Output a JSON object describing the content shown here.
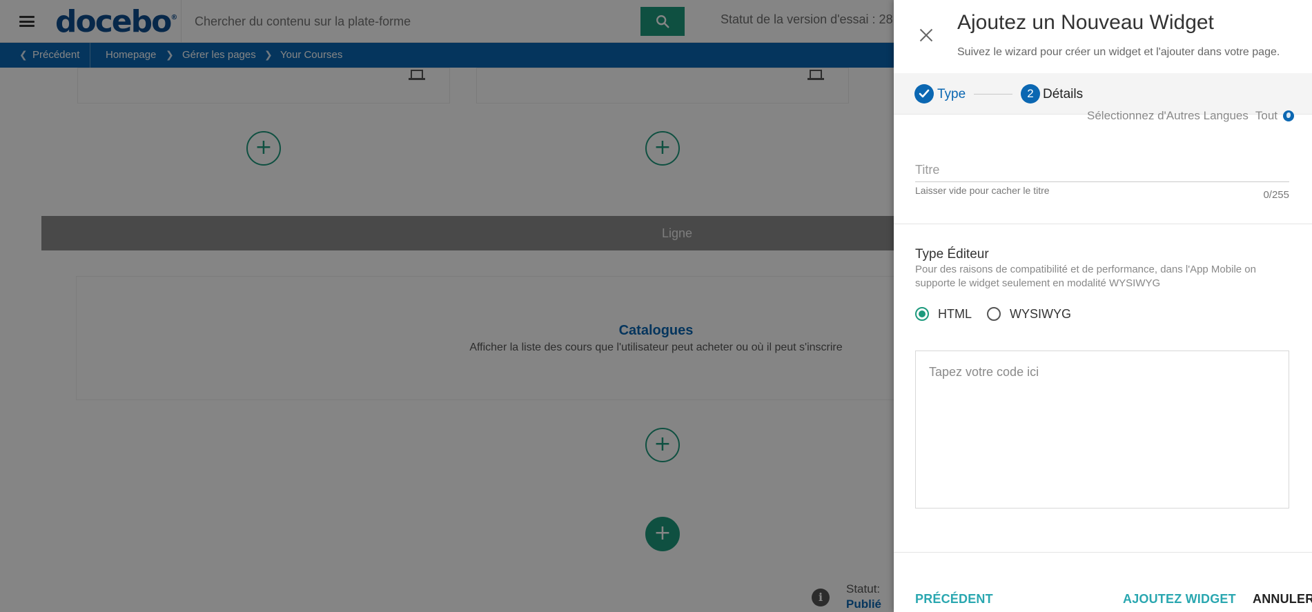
{
  "header": {
    "logo": "docebo",
    "logo_mark": "®",
    "search_placeholder": "Chercher du contenu sur la plate-forme",
    "trial_status": "Statut de la version d'essai : 28"
  },
  "breadcrumb": {
    "back": "Précédent",
    "items": [
      "Homepage",
      "Gérer les pages",
      "Your Courses"
    ]
  },
  "page": {
    "row_label": "Ligne",
    "catalog_title": "Catalogues",
    "catalog_desc": "Afficher la liste des cours que l'utilisateur peut acheter ou où il peut s'inscrire",
    "add_symbol": "+",
    "status_label": "Statut:",
    "status_value": "Publié",
    "info_symbol": "i"
  },
  "panel": {
    "title": "Ajoutez un Nouveau Widget",
    "subtitle": "Suivez le wizard pour créer un widget et l'ajouter dans votre page.",
    "steps": [
      {
        "number": "1",
        "label": "Type",
        "done": true
      },
      {
        "number": "2",
        "label": "Détails",
        "done": false
      }
    ],
    "languages_label": "Sélectionnez d'Autres Langues",
    "languages_value": "Tout",
    "title_field": {
      "placeholder": "Titre",
      "value": "",
      "help": "Laisser vide pour cacher le titre",
      "counter": "0/255"
    },
    "editor": {
      "label": "Type Éditeur",
      "help": "Pour des raisons de compatibilité et de performance, dans l'App Mobile on supporte le widget seulement en modalité WYSIWYG",
      "options": [
        "HTML",
        "WYSIWYG"
      ],
      "selected": "HTML"
    },
    "code_placeholder": "Tapez votre code ici",
    "footer": {
      "previous": "PRÉCÉDENT",
      "add": "AJOUTEZ WIDGET",
      "cancel": "ANNULER"
    }
  },
  "colors": {
    "brand_blue": "#0b67b2",
    "accent_green": "#1d9a7d",
    "action_teal": "#2aa7b0"
  },
  "icons": [
    "hamburger-icon",
    "search-icon",
    "laptop-icon",
    "plus-icon",
    "info-icon",
    "close-icon",
    "check-icon",
    "globe-icon",
    "chevron-left-icon",
    "chevron-right-icon"
  ]
}
